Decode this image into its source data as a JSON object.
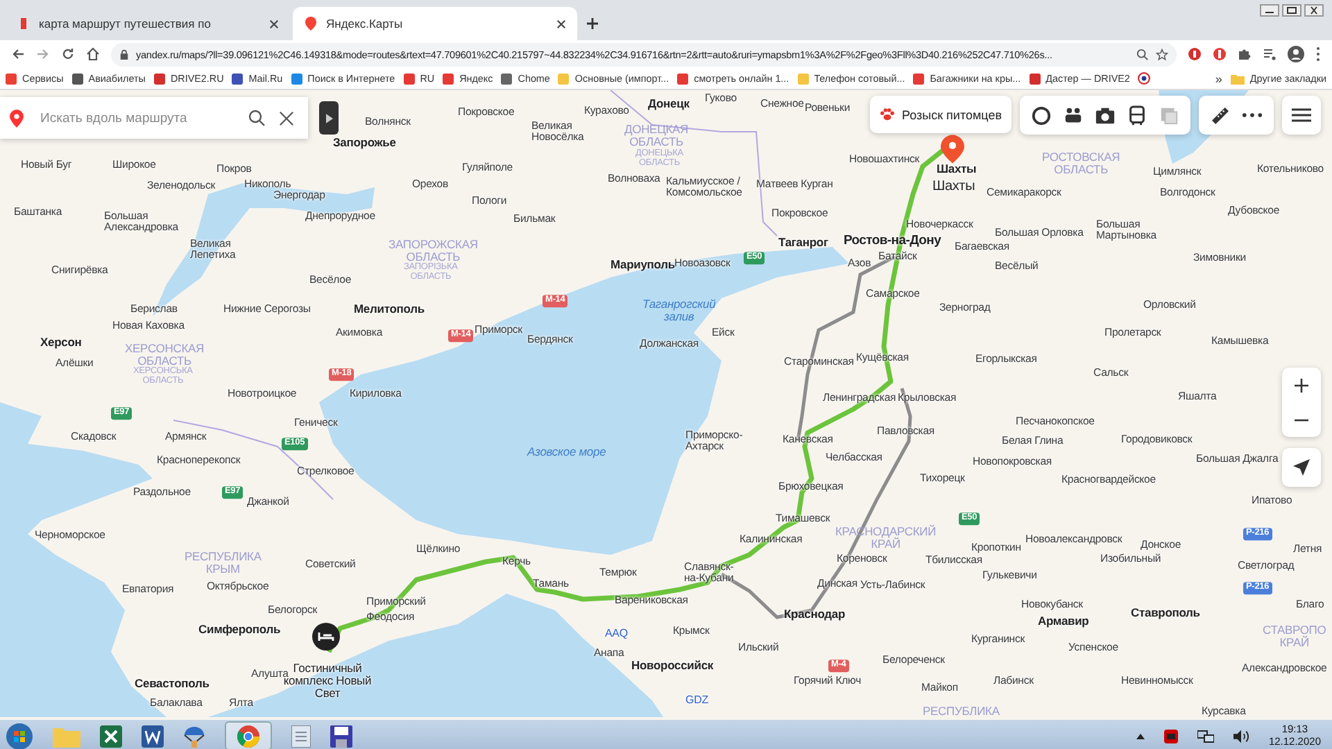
{
  "browser": {
    "tabs": [
      {
        "title": "карта маршрут путешествия по",
        "selected": false
      },
      {
        "title": "Яндекс.Карты",
        "selected": true
      }
    ],
    "url": "yandex.ru/maps/?ll=39.096121%2C46.149318&mode=routes&rtext=47.709601%2C40.215797~44.832234%2C34.916716&rtn=2&rtt=auto&ruri=ymapsbm1%3A%2F%2Fgeo%3Fll%3D40.216%252C47.710%26s...",
    "bookmarks": [
      "Сервисы",
      "Авиабилеты",
      "DRIVE2.RU",
      "Mail.Ru",
      "Поиск в Интернете",
      "RU",
      "Яндекс",
      "Chome",
      "Основные (импорт...",
      "смотреть онлайн 1...",
      "Телефон сотовый...",
      "Багажники на кры...",
      "Дастер — DRIVE2"
    ],
    "bookmarks_more": "»",
    "other_bookmarks": "Другие закладки"
  },
  "map": {
    "search": {
      "placeholder": "Искать вдоль маршрута"
    },
    "pet_search_button": "Розыск питомцев",
    "labels": [
      {
        "text": "Покровское",
        "kind": "town"
      },
      {
        "text": "Курахово",
        "kind": "town"
      },
      {
        "text": "Донецк",
        "kind": "city"
      },
      {
        "text": "Гуково",
        "kind": "town"
      },
      {
        "text": "Снежное",
        "kind": "town"
      },
      {
        "text": "Ровеньки",
        "kind": "town"
      },
      {
        "text": "Волнянск",
        "kind": "town"
      },
      {
        "text": "Запорожье",
        "kind": "city"
      },
      {
        "text": "Великая\nНовосёлка",
        "kind": "town"
      },
      {
        "text": "ДОНЕЦКАЯ\nОБЛАСТЬ",
        "kind": "region"
      },
      {
        "text": "Новый Буг",
        "kind": "town"
      },
      {
        "text": "Широкое",
        "kind": "town"
      },
      {
        "text": "Покров",
        "kind": "town"
      },
      {
        "text": "Гуляйполе",
        "kind": "town"
      },
      {
        "text": "ДОНЕЦЬКА\nОБЛАСТЬ",
        "kind": "region-local"
      },
      {
        "text": "Новошахтинск",
        "kind": "town"
      },
      {
        "text": "Шахты",
        "kind": "city"
      },
      {
        "text": "РОСТОВСКАЯ\nОБЛАСТЬ",
        "kind": "region"
      },
      {
        "text": "Цимлянск",
        "kind": "town"
      },
      {
        "text": "Котельниково",
        "kind": "town"
      },
      {
        "text": "Зеленодольск",
        "kind": "town"
      },
      {
        "text": "Никополь",
        "kind": "town"
      },
      {
        "text": "Энергодар",
        "kind": "town"
      },
      {
        "text": "Орехов",
        "kind": "town"
      },
      {
        "text": "Волноваха",
        "kind": "town"
      },
      {
        "text": "Кальмиусское /\nКомсомольское",
        "kind": "town"
      },
      {
        "text": "Матвеев Курган",
        "kind": "town"
      },
      {
        "text": "Шахты",
        "kind": "destination"
      },
      {
        "text": "Семикаракорск",
        "kind": "town"
      },
      {
        "text": "Волгодонск",
        "kind": "town"
      },
      {
        "text": "Баштанка",
        "kind": "town"
      },
      {
        "text": "Большая\nАлександровка",
        "kind": "town"
      },
      {
        "text": "Днепрорудное",
        "kind": "town"
      },
      {
        "text": "Пологи",
        "kind": "town"
      },
      {
        "text": "Бильмак",
        "kind": "town"
      },
      {
        "text": "Покровское",
        "kind": "town"
      },
      {
        "text": "Новочеркасск",
        "kind": "town"
      },
      {
        "text": "Дубовское",
        "kind": "town"
      },
      {
        "text": "Таганрог",
        "kind": "city"
      },
      {
        "text": "Ростов-на-Дону",
        "kind": "capital"
      },
      {
        "text": "Багаевская",
        "kind": "town"
      },
      {
        "text": "Большая Орловка",
        "kind": "town"
      },
      {
        "text": "Большая\nМартыновка",
        "kind": "town"
      },
      {
        "text": "Снигирёвка",
        "kind": "town"
      },
      {
        "text": "Великая\nЛепетиха",
        "kind": "town"
      },
      {
        "text": "ЗАПОРОЖСКАЯ\nОБЛАСТЬ",
        "kind": "region"
      },
      {
        "text": "Мариуполь",
        "kind": "city"
      },
      {
        "text": "Новоазовск",
        "kind": "town"
      },
      {
        "text": "E50",
        "kind": "road-e"
      },
      {
        "text": "Азов",
        "kind": "town"
      },
      {
        "text": "Батайск",
        "kind": "town"
      },
      {
        "text": "Весёлый",
        "kind": "town"
      },
      {
        "text": "Зимовники",
        "kind": "town"
      },
      {
        "text": "Весёлое",
        "kind": "town"
      },
      {
        "text": "ЗАПОРІЗЬКА\nОБЛАСТЬ",
        "kind": "region-local"
      },
      {
        "text": "Самарское",
        "kind": "town"
      },
      {
        "text": "Берислав",
        "kind": "town"
      },
      {
        "text": "Нижние Серогозы",
        "kind": "town"
      },
      {
        "text": "Мелитополь",
        "kind": "city"
      },
      {
        "text": "M-14",
        "kind": "road-m"
      },
      {
        "text": "Таганрогский\nзалив",
        "kind": "water"
      },
      {
        "text": "Зерноград",
        "kind": "town"
      },
      {
        "text": "Орловский",
        "kind": "town"
      },
      {
        "text": "Херсон",
        "kind": "city"
      },
      {
        "text": "Новая Каховка",
        "kind": "town"
      },
      {
        "text": "Акимовка",
        "kind": "town"
      },
      {
        "text": "M-14",
        "kind": "road-m"
      },
      {
        "text": "Приморск",
        "kind": "town"
      },
      {
        "text": "Бердянск",
        "kind": "town"
      },
      {
        "text": "Должанская",
        "kind": "town"
      },
      {
        "text": "Ейск",
        "kind": "town"
      },
      {
        "text": "Пролетарск",
        "kind": "town"
      },
      {
        "text": "Камышевка",
        "kind": "town"
      },
      {
        "text": "Алёшки",
        "kind": "town"
      },
      {
        "text": "ХЕРСОНСКАЯ\nОБЛАСТЬ",
        "kind": "region"
      },
      {
        "text": "ХЕРСОНСЬКА\nОБЛАСТЬ",
        "kind": "region-local"
      },
      {
        "text": "M-18",
        "kind": "road-m"
      },
      {
        "text": "Староминская",
        "kind": "town"
      },
      {
        "text": "Кущёвская",
        "kind": "town"
      },
      {
        "text": "Егорлыкская",
        "kind": "town"
      },
      {
        "text": "Сальск",
        "kind": "town"
      },
      {
        "text": "Новотроицкое",
        "kind": "town"
      },
      {
        "text": "Кириловка",
        "kind": "town"
      },
      {
        "text": "Ленинградская",
        "kind": "town"
      },
      {
        "text": "Крыловская",
        "kind": "town"
      },
      {
        "text": "Яшалта",
        "kind": "town"
      },
      {
        "text": "E97",
        "kind": "road-e"
      },
      {
        "text": "Геническ",
        "kind": "town"
      },
      {
        "text": "Песчанокопское",
        "kind": "town"
      },
      {
        "text": "Скадовск",
        "kind": "town"
      },
      {
        "text": "Армянск",
        "kind": "town"
      },
      {
        "text": "E105",
        "kind": "road-e"
      },
      {
        "text": "Азовское море",
        "kind": "water"
      },
      {
        "text": "Приморско-\nАхтарск",
        "kind": "town"
      },
      {
        "text": "Каневская",
        "kind": "town"
      },
      {
        "text": "Павловская",
        "kind": "town"
      },
      {
        "text": "Белая Глина",
        "kind": "town"
      },
      {
        "text": "Городовиковск",
        "kind": "town"
      },
      {
        "text": "Красноперекопск",
        "kind": "town"
      },
      {
        "text": "Стрелковое",
        "kind": "town"
      },
      {
        "text": "Челбасская",
        "kind": "town"
      },
      {
        "text": "Новопокровская",
        "kind": "town"
      },
      {
        "text": "Большая Джалга",
        "kind": "town"
      },
      {
        "text": "Раздольное",
        "kind": "town"
      },
      {
        "text": "E97",
        "kind": "road-e"
      },
      {
        "text": "Джанкой",
        "kind": "town"
      },
      {
        "text": "Брюховецкая",
        "kind": "town"
      },
      {
        "text": "Тихорецк",
        "kind": "town"
      },
      {
        "text": "Красногвардейское",
        "kind": "town"
      },
      {
        "text": "Ипатово",
        "kind": "town"
      },
      {
        "text": "Тимашевск",
        "kind": "town"
      },
      {
        "text": "E50",
        "kind": "road-e"
      },
      {
        "text": "Черноморское",
        "kind": "town"
      },
      {
        "text": "Щёлкино",
        "kind": "town"
      },
      {
        "text": "Калининская",
        "kind": "town"
      },
      {
        "text": "КРАСНОДАРСКИЙ\nКРАЙ",
        "kind": "region"
      },
      {
        "text": "Кропоткин",
        "kind": "town"
      },
      {
        "text": "Новоалександровск",
        "kind": "town"
      },
      {
        "text": "Донское",
        "kind": "town"
      },
      {
        "text": "Р-216",
        "kind": "road-r"
      },
      {
        "text": "Летня",
        "kind": "town"
      },
      {
        "text": "РЕСПУБЛИКА\nКРЫМ",
        "kind": "region"
      },
      {
        "text": "Советский",
        "kind": "town"
      },
      {
        "text": "Керчь",
        "kind": "town"
      },
      {
        "text": "Темрюк",
        "kind": "town"
      },
      {
        "text": "Славянск-\nна-Кубани",
        "kind": "town"
      },
      {
        "text": "Кореновск",
        "kind": "town"
      },
      {
        "text": "Тбилисская",
        "kind": "town"
      },
      {
        "text": "Гулькевичи",
        "kind": "town"
      },
      {
        "text": "Изобильный",
        "kind": "town"
      },
      {
        "text": "Светлоград",
        "kind": "town"
      },
      {
        "text": "Евпатория",
        "kind": "town"
      },
      {
        "text": "Октябрьское",
        "kind": "town"
      },
      {
        "text": "Тамань",
        "kind": "town"
      },
      {
        "text": "Динская",
        "kind": "town"
      },
      {
        "text": "Усть-Лабинск",
        "kind": "town"
      },
      {
        "text": "Р-216",
        "kind": "road-r"
      },
      {
        "text": "Белогорск",
        "kind": "town"
      },
      {
        "text": "Приморский",
        "kind": "town"
      },
      {
        "text": "Феодосия",
        "kind": "town"
      },
      {
        "text": "Варениковская",
        "kind": "town"
      },
      {
        "text": "Краснодар",
        "kind": "city"
      },
      {
        "text": "Новокубанск",
        "kind": "town"
      },
      {
        "text": "Армавир",
        "kind": "city"
      },
      {
        "text": "Ставрополь",
        "kind": "city"
      },
      {
        "text": "Благо",
        "kind": "town"
      },
      {
        "text": "Симферополь",
        "kind": "city"
      },
      {
        "text": "AAQ",
        "kind": "airport"
      },
      {
        "text": "Крымск",
        "kind": "town"
      },
      {
        "text": "Ильский",
        "kind": "town"
      },
      {
        "text": "Курганинск",
        "kind": "town"
      },
      {
        "text": "Успенское",
        "kind": "town"
      },
      {
        "text": "СТАВРОПО\nКРАЙ",
        "kind": "region"
      },
      {
        "text": "Алушта",
        "kind": "town"
      },
      {
        "text": "Гостиничный\nкомплекс Новый\nСвет",
        "kind": "poi"
      },
      {
        "text": "Анапа",
        "kind": "town"
      },
      {
        "text": "Новороссийск",
        "kind": "city"
      },
      {
        "text": "Горячий Ключ",
        "kind": "town"
      },
      {
        "text": "M-4",
        "kind": "road-m"
      },
      {
        "text": "Белореченск",
        "kind": "town"
      },
      {
        "text": "Майкоп",
        "kind": "town"
      },
      {
        "text": "Лабинск",
        "kind": "town"
      },
      {
        "text": "Невинномысск",
        "kind": "town"
      },
      {
        "text": "Александровское",
        "kind": "town"
      },
      {
        "text": "Севастополь",
        "kind": "city"
      },
      {
        "text": "Балаклава",
        "kind": "town"
      },
      {
        "text": "Ялта",
        "kind": "town"
      },
      {
        "text": "GDZ",
        "kind": "airport"
      },
      {
        "text": "РЕСПУБЛИКА",
        "kind": "region"
      },
      {
        "text": "Курсавка",
        "kind": "town"
      }
    ]
  },
  "taskbar": {
    "time": "19:13",
    "date": "12.12.2020"
  }
}
